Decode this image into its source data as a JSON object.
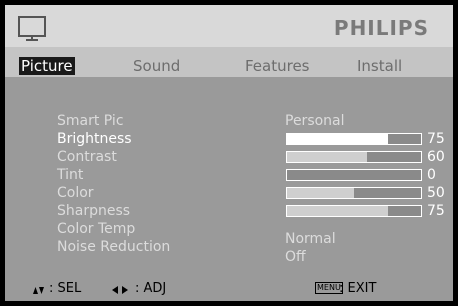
{
  "header": {
    "brand": "PHILIPS",
    "icon": "tv-icon"
  },
  "tabs": [
    {
      "label": "Picture",
      "active": true
    },
    {
      "label": "Sound",
      "active": false
    },
    {
      "label": "Features",
      "active": false
    },
    {
      "label": "Install",
      "active": false
    }
  ],
  "rows": [
    {
      "label": "Smart Pic",
      "value": "Personal"
    },
    {
      "label": "Brightness",
      "level": 75,
      "value": "75",
      "highlighted": true
    },
    {
      "label": "Contrast",
      "level": 60,
      "value": "60"
    },
    {
      "label": "Tint",
      "level": 0,
      "value": "0"
    },
    {
      "label": "Color",
      "level": 50,
      "value": "50"
    },
    {
      "label": "Sharpness",
      "level": 75,
      "value": "75"
    },
    {
      "label": "Color Temp",
      "value": "Normal"
    },
    {
      "label": "Noise Reduction",
      "value": "Off"
    }
  ],
  "footer": {
    "sel_icon": "up-down-arrows-icon",
    "sel_label": ": SEL",
    "adj_icon": "left-right-arrows-icon",
    "adj_label": ": ADJ",
    "menu_key": "MENU",
    "exit_label": ": EXIT"
  },
  "colors": {
    "panel": "#9a9a9a",
    "header": "#d9d9d9",
    "tabbar": "#c4c4c4",
    "active_tab": "#1a1a1a"
  }
}
